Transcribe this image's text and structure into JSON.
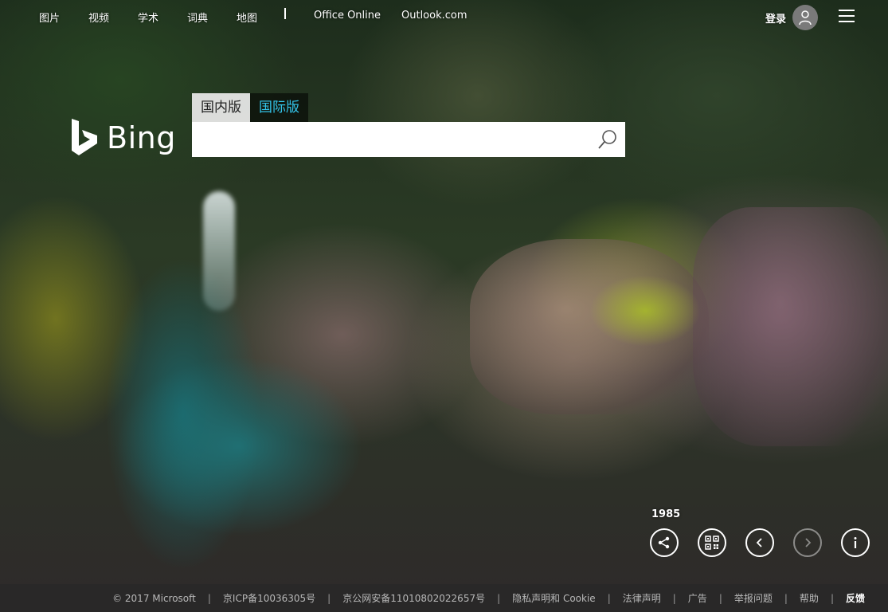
{
  "topnav": {
    "items": [
      "图片",
      "视频",
      "学术",
      "词典",
      "地图"
    ],
    "office": "Office Online",
    "outlook": "Outlook.com",
    "login": "登录"
  },
  "logo": {
    "text": "Bing"
  },
  "market_tabs": [
    "国内版",
    "国际版"
  ],
  "search": {
    "value": "",
    "placeholder": ""
  },
  "year": "1985",
  "footer": {
    "copyright": "© 2017 Microsoft",
    "icp": "京ICP备10036305号",
    "police": "京公网安备11010802022657号",
    "privacy": "隐私声明和 Cookie",
    "legal": "法律声明",
    "ads": "广告",
    "report": "举报问题",
    "help": "帮助",
    "feedback": "反馈"
  },
  "icons": [
    "avatar-icon",
    "menu-icon",
    "bing-logo-icon",
    "search-icon",
    "share-icon",
    "qr-code-icon",
    "prev-icon",
    "next-icon",
    "info-icon"
  ],
  "colors": {
    "intl_tab": "#33c3e8",
    "footer_bg": "#282828"
  }
}
